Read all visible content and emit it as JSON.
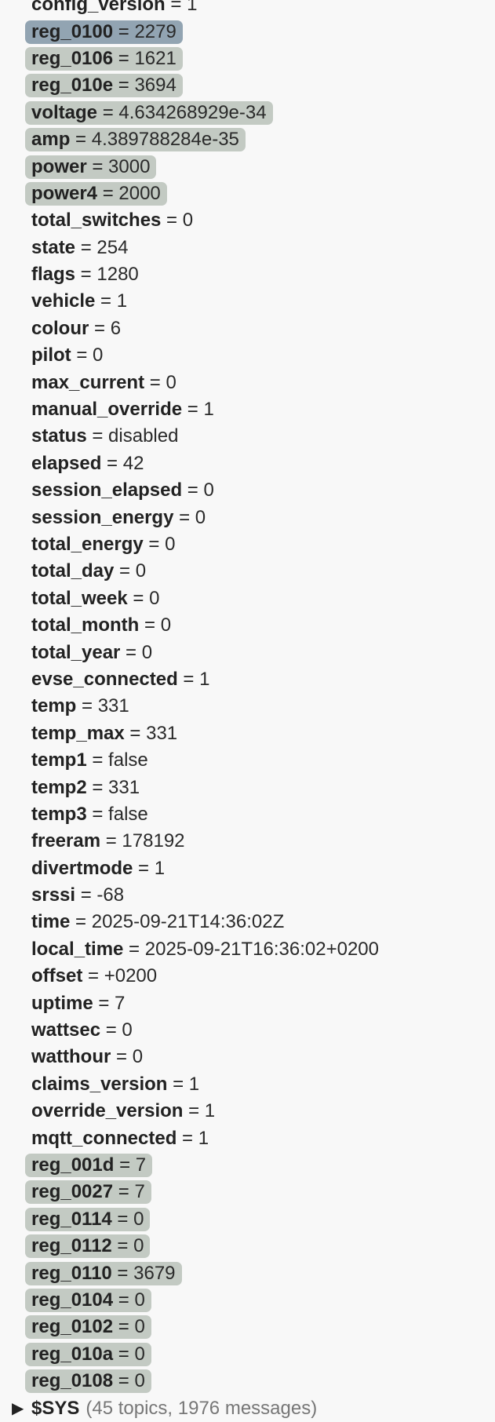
{
  "tree": {
    "partial_top": {
      "key": "config_version",
      "value": "1"
    },
    "topics": [
      {
        "key": "reg_0100",
        "value": "2279",
        "highlight": "selected"
      },
      {
        "key": "reg_0106",
        "value": "1621",
        "highlight": "hl"
      },
      {
        "key": "reg_010e",
        "value": "3694",
        "highlight": "hl"
      },
      {
        "key": "voltage",
        "value": "4.634268929e-34",
        "highlight": "hl"
      },
      {
        "key": "amp",
        "value": "4.389788284e-35",
        "highlight": "hl"
      },
      {
        "key": "power",
        "value": "3000",
        "highlight": "hl"
      },
      {
        "key": "power4",
        "value": "2000",
        "highlight": "hl"
      },
      {
        "key": "total_switches",
        "value": "0",
        "highlight": ""
      },
      {
        "key": "state",
        "value": "254",
        "highlight": ""
      },
      {
        "key": "flags",
        "value": "1280",
        "highlight": ""
      },
      {
        "key": "vehicle",
        "value": "1",
        "highlight": ""
      },
      {
        "key": "colour",
        "value": "6",
        "highlight": ""
      },
      {
        "key": "pilot",
        "value": "0",
        "highlight": ""
      },
      {
        "key": "max_current",
        "value": "0",
        "highlight": ""
      },
      {
        "key": "manual_override",
        "value": "1",
        "highlight": ""
      },
      {
        "key": "status",
        "value": "disabled",
        "highlight": ""
      },
      {
        "key": "elapsed",
        "value": "42",
        "highlight": ""
      },
      {
        "key": "session_elapsed",
        "value": "0",
        "highlight": ""
      },
      {
        "key": "session_energy",
        "value": "0",
        "highlight": ""
      },
      {
        "key": "total_energy",
        "value": "0",
        "highlight": ""
      },
      {
        "key": "total_day",
        "value": "0",
        "highlight": ""
      },
      {
        "key": "total_week",
        "value": "0",
        "highlight": ""
      },
      {
        "key": "total_month",
        "value": "0",
        "highlight": ""
      },
      {
        "key": "total_year",
        "value": "0",
        "highlight": ""
      },
      {
        "key": "evse_connected",
        "value": "1",
        "highlight": ""
      },
      {
        "key": "temp",
        "value": "331",
        "highlight": ""
      },
      {
        "key": "temp_max",
        "value": "331",
        "highlight": ""
      },
      {
        "key": "temp1",
        "value": "false",
        "highlight": ""
      },
      {
        "key": "temp2",
        "value": "331",
        "highlight": ""
      },
      {
        "key": "temp3",
        "value": "false",
        "highlight": ""
      },
      {
        "key": "freeram",
        "value": "178192",
        "highlight": ""
      },
      {
        "key": "divertmode",
        "value": "1",
        "highlight": ""
      },
      {
        "key": "srssi",
        "value": "-68",
        "highlight": ""
      },
      {
        "key": "time",
        "value": "2025-09-21T14:36:02Z",
        "highlight": ""
      },
      {
        "key": "local_time",
        "value": "2025-09-21T16:36:02+0200",
        "highlight": ""
      },
      {
        "key": "offset",
        "value": "+0200",
        "highlight": ""
      },
      {
        "key": "uptime",
        "value": "7",
        "highlight": ""
      },
      {
        "key": "wattsec",
        "value": "0",
        "highlight": ""
      },
      {
        "key": "watthour",
        "value": "0",
        "highlight": ""
      },
      {
        "key": "claims_version",
        "value": "1",
        "highlight": ""
      },
      {
        "key": "override_version",
        "value": "1",
        "highlight": ""
      },
      {
        "key": "mqtt_connected",
        "value": "1",
        "highlight": ""
      },
      {
        "key": "reg_001d",
        "value": "7",
        "highlight": "hl"
      },
      {
        "key": "reg_0027",
        "value": "7",
        "highlight": "hl"
      },
      {
        "key": "reg_0114",
        "value": "0",
        "highlight": "hl"
      },
      {
        "key": "reg_0112",
        "value": "0",
        "highlight": "hl"
      },
      {
        "key": "reg_0110",
        "value": "3679",
        "highlight": "hl"
      },
      {
        "key": "reg_0104",
        "value": "0",
        "highlight": "hl"
      },
      {
        "key": "reg_0102",
        "value": "0",
        "highlight": "hl"
      },
      {
        "key": "reg_010a",
        "value": "0",
        "highlight": "hl"
      },
      {
        "key": "reg_0108",
        "value": "0",
        "highlight": "hl"
      }
    ],
    "folder": {
      "arrow": "▶",
      "name": "$SYS",
      "meta": "(45 topics, 1976 messages)"
    },
    "separator": " = "
  }
}
